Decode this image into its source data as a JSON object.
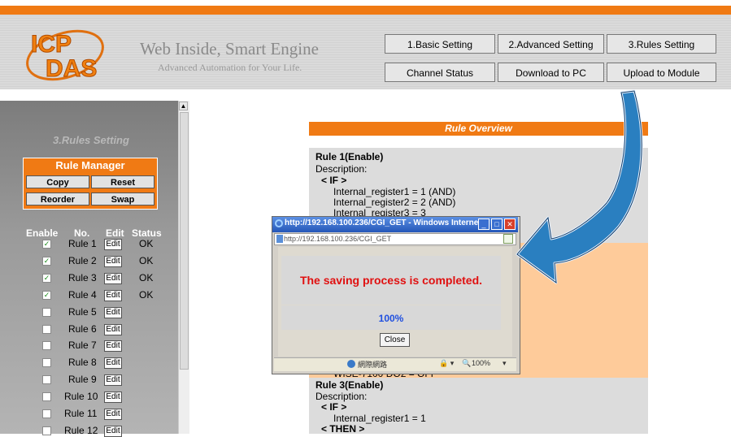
{
  "header": {
    "brand": "ICP DAS",
    "tagline": "Web Inside, Smart Engine",
    "subtagline": "Advanced Automation for Your Life.",
    "nav": [
      {
        "label": "1.Basic Setting"
      },
      {
        "label": "2.Advanced Setting"
      },
      {
        "label": "3.Rules Setting"
      },
      {
        "label": "Channel Status"
      },
      {
        "label": "Download to PC"
      },
      {
        "label": "Upload to Module"
      }
    ]
  },
  "sidebar": {
    "title": "3.Rules Setting",
    "rule_manager": {
      "title": "Rule Manager",
      "buttons": [
        "Copy",
        "Reset",
        "Reorder",
        "Swap"
      ]
    },
    "columns": [
      "Enable",
      "No.",
      "Edit",
      "Status"
    ],
    "edit_label": "Edit",
    "rules": [
      {
        "name": "Rule 1",
        "checked": true,
        "status": "OK"
      },
      {
        "name": "Rule 2",
        "checked": true,
        "status": "OK"
      },
      {
        "name": "Rule 3",
        "checked": true,
        "status": "OK"
      },
      {
        "name": "Rule 4",
        "checked": true,
        "status": "OK"
      },
      {
        "name": "Rule 5",
        "checked": false,
        "status": ""
      },
      {
        "name": "Rule 6",
        "checked": false,
        "status": ""
      },
      {
        "name": "Rule 7",
        "checked": false,
        "status": ""
      },
      {
        "name": "Rule 8",
        "checked": false,
        "status": ""
      },
      {
        "name": "Rule 9",
        "checked": false,
        "status": ""
      },
      {
        "name": "Rule 10",
        "checked": false,
        "status": ""
      },
      {
        "name": "Rule 11",
        "checked": false,
        "status": ""
      },
      {
        "name": "Rule 12",
        "checked": false,
        "status": ""
      }
    ]
  },
  "overview": {
    "title": "Rule Overview",
    "rule1": {
      "heading": "Rule 1(Enable)",
      "description": "Description:",
      "if_label": "< IF >",
      "lines": [
        "Internal_register1 = 1 (AND)",
        "Internal_register2 = 2 (AND)",
        "Internal_register3 = 3"
      ]
    },
    "rule2_partial": "WISE-7100 DO2 = OFF",
    "rule3": {
      "heading": "Rule 3(Enable)",
      "description": "Description:",
      "if_label": "< IF >",
      "lines": [
        "Internal_register1 = 1"
      ],
      "then_label": "< THEN >"
    }
  },
  "popup": {
    "title": "http://192.168.100.236/CGI_GET - Windows Interne...",
    "url": "http://192.168.100.236/CGI_GET",
    "message": "The saving process is completed.",
    "percent": "100%",
    "close_label": "Close",
    "status_zone": "網際網路",
    "zoom": "100%"
  },
  "colors": {
    "accent_orange": "#f07a14",
    "peach": "#fecb9a",
    "message_red": "#e01010",
    "percent_blue": "#1f4fe0",
    "arrow_blue": "#1e6fa8"
  }
}
